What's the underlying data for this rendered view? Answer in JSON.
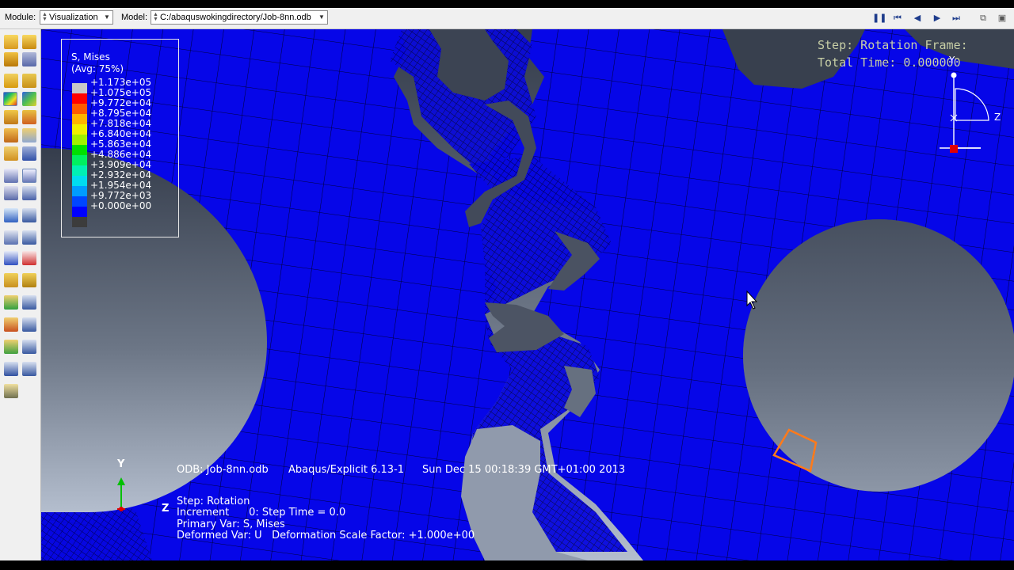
{
  "toolbar": {
    "module_label": "Module:",
    "module_value": "Visualization",
    "model_label": "Model:",
    "model_value": "C:/abaquswokingdirectory/Job-8nn.odb"
  },
  "legend": {
    "title": "S, Mises",
    "subtitle": "(Avg: 75%)",
    "entries": [
      {
        "value": "+1.173e+05",
        "color": "#c8c8c8"
      },
      {
        "value": "+1.075e+05",
        "color": "#ff0000"
      },
      {
        "value": "+9.772e+04",
        "color": "#ff5a00"
      },
      {
        "value": "+8.795e+04",
        "color": "#ffb400"
      },
      {
        "value": "+7.818e+04",
        "color": "#f0f000"
      },
      {
        "value": "+6.840e+04",
        "color": "#a0f000"
      },
      {
        "value": "+5.863e+04",
        "color": "#00e000"
      },
      {
        "value": "+4.886e+04",
        "color": "#00f060"
      },
      {
        "value": "+3.909e+04",
        "color": "#00f0b4"
      },
      {
        "value": "+2.932e+04",
        "color": "#00dcf0"
      },
      {
        "value": "+1.954e+04",
        "color": "#009cff"
      },
      {
        "value": "+9.772e+03",
        "color": "#0046ff"
      },
      {
        "value": "+0.000e+00",
        "color": "#0000ff"
      },
      {
        "value": "",
        "color": "#3c3c3c"
      }
    ]
  },
  "step_info": {
    "step_frame": "Step: Rotation Frame:",
    "total_time": "Total Time: 0.000000"
  },
  "triad_top": {
    "y": "Y",
    "z": "Z"
  },
  "triad_bottom": {
    "y": "Y",
    "z": "Z"
  },
  "odb_line": {
    "odb": "ODB: Job-8nn.odb",
    "solver": "Abaqus/Explicit 6.13-1",
    "date": "Sun Dec 15 00:18:39 GMT+01:00 2013"
  },
  "state_block": {
    "step": "Step: Rotation",
    "increment": "Increment      0: Step Time = 0.0",
    "primary": "Primary Var: S, Mises",
    "deformed": "Deformed Var: U   Deformation Scale Factor: +1.000e+00"
  },
  "colors": {
    "mesh_blue": "#0505e6",
    "mesh_line": "#000050",
    "background_top": "#3a4250",
    "background_bottom": "#aeb8c8",
    "highlight": "#ff7a1a"
  },
  "icons": [
    "query-icon",
    "probe-icon",
    "set-icon",
    "group-icon",
    "plot-undeformed-icon",
    "plot-deformed-icon",
    "contour-plot-icon",
    "contour-options-icon",
    "symbol-plot-icon",
    "symbol-options-icon",
    "material-orientation-icon",
    "orientation-options-icon",
    "overlay-plot-icon",
    "viewport-layers-icon",
    "animate-icon",
    "animation-options-icon",
    "xy-data-icon",
    "xy-plot-icon",
    "path-icon",
    "report-icon",
    "free-body-icon",
    "display-group-icon",
    "view-cut-icon",
    "cut-manager-icon",
    "stream-icon",
    "stream-manager-icon",
    "create-field-output-icon",
    "field-output-manager-icon",
    "stress-linearization-icon",
    "common-options-icon",
    "superimpose-icon",
    "edit-icon",
    "tool-icon"
  ]
}
